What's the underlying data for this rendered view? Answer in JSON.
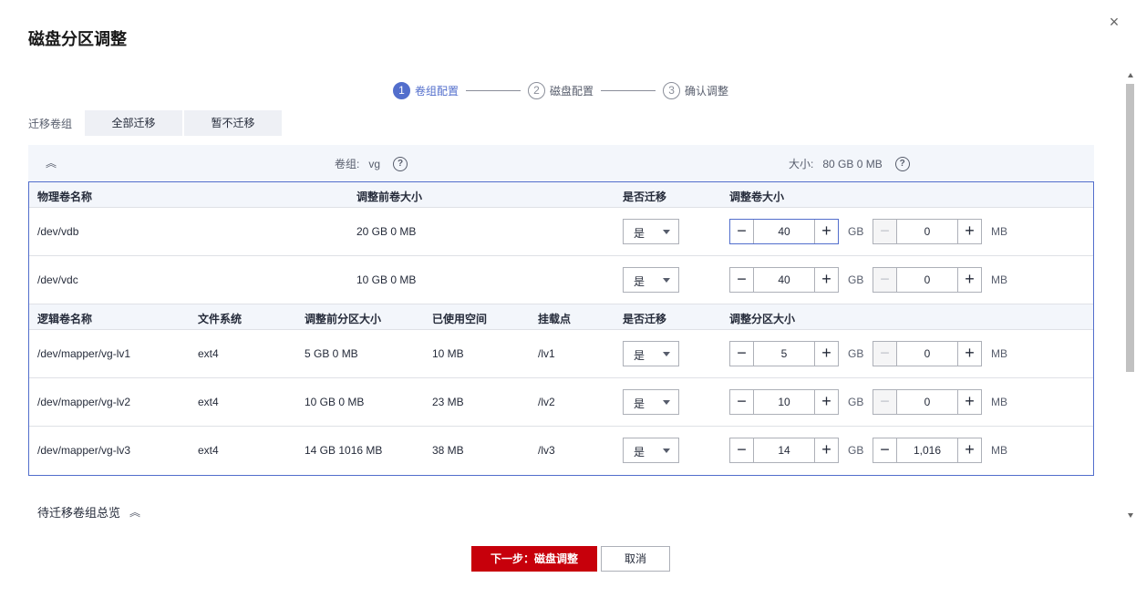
{
  "dialog": {
    "title": "磁盘分区调整",
    "close": "×"
  },
  "steps": [
    {
      "num": "1",
      "label": "卷组配置"
    },
    {
      "num": "2",
      "label": "磁盘配置"
    },
    {
      "num": "3",
      "label": "确认调整"
    }
  ],
  "migrate": {
    "label": "迁移卷组",
    "all": "全部迁移",
    "none": "暂不迁移"
  },
  "vg": {
    "name_label": "卷组:",
    "name": "vg",
    "size_label": "大小:",
    "size": "80 GB 0 MB"
  },
  "pv_headers": {
    "name": "物理卷名称",
    "before": "调整前卷大小",
    "migrate": "是否迁移",
    "adjust": "调整卷大小"
  },
  "pv_rows": [
    {
      "name": "/dev/vdb",
      "before": "20 GB 0 MB",
      "migrate": "是",
      "gb": "40",
      "mb": "0"
    },
    {
      "name": "/dev/vdc",
      "before": "10 GB 0 MB",
      "migrate": "是",
      "gb": "40",
      "mb": "0"
    }
  ],
  "lv_headers": {
    "name": "逻辑卷名称",
    "fs": "文件系统",
    "before": "调整前分区大小",
    "used": "已使用空间",
    "mount": "挂载点",
    "migrate": "是否迁移",
    "adjust": "调整分区大小"
  },
  "lv_rows": [
    {
      "name": "/dev/mapper/vg-lv1",
      "fs": "ext4",
      "before": "5 GB 0 MB",
      "used": "10 MB",
      "mount": "/lv1",
      "migrate": "是",
      "gb": "5",
      "mb": "0"
    },
    {
      "name": "/dev/mapper/vg-lv2",
      "fs": "ext4",
      "before": "10 GB 0 MB",
      "used": "23 MB",
      "mount": "/lv2",
      "migrate": "是",
      "gb": "10",
      "mb": "0"
    },
    {
      "name": "/dev/mapper/vg-lv3",
      "fs": "ext4",
      "before": "14 GB 1016 MB",
      "used": "38 MB",
      "mount": "/lv3",
      "migrate": "是",
      "gb": "14",
      "mb": "1,016"
    }
  ],
  "units": {
    "gb": "GB",
    "mb": "MB"
  },
  "summary": {
    "label": "待迁移卷组总览"
  },
  "footer": {
    "next": "下一步：磁盘调整",
    "cancel": "取消"
  },
  "colors": {
    "primary": "#c7000b",
    "accent": "#526ecc",
    "header_bg": "#f3f6fb"
  }
}
